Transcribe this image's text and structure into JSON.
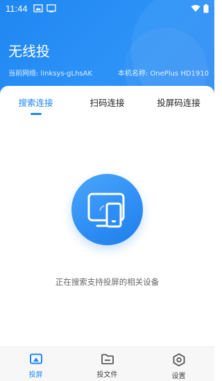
{
  "status_bar": {
    "time": "11:44",
    "icons": [
      "image-icon",
      "cast-icon",
      "wifi-icon",
      "battery-icon"
    ]
  },
  "app": {
    "title": "无线投",
    "network_label": "当前网络: linksys-gLhsAK",
    "device_label": "本机名称: OnePlus HD1910"
  },
  "tabs": [
    {
      "label": "搜索连接",
      "active": true
    },
    {
      "label": "扫码连接",
      "active": false
    },
    {
      "label": "投屏码连接",
      "active": false
    }
  ],
  "search": {
    "icon": "screen-cast-device-icon",
    "message": "正在搜索支持投屏的相关设备"
  },
  "bottom_nav": [
    {
      "label": "投屏",
      "icon": "cast-screen-icon",
      "active": true
    },
    {
      "label": "投文件",
      "icon": "folder-icon",
      "active": false
    },
    {
      "label": "设置",
      "icon": "settings-icon",
      "active": false
    }
  ],
  "colors": {
    "accent": "#1f87f2",
    "header_bg": "#2a8ff5",
    "text": "#222222",
    "muted": "#666666"
  }
}
